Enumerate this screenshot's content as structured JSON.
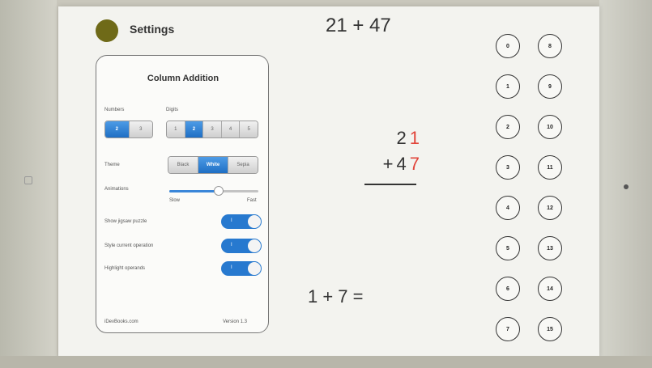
{
  "header": {
    "settings_label": "Settings"
  },
  "panel": {
    "title": "Column Addition",
    "numbers_label": "Numbers",
    "numbers_options": [
      "2",
      "3"
    ],
    "digits_label": "Digits",
    "digits_options": [
      "1",
      "2",
      "3",
      "4",
      "5"
    ],
    "theme_label": "Theme",
    "theme_options": [
      "Black",
      "White",
      "Sepia"
    ],
    "animations_label": "Animations",
    "anim_slow": "Slow",
    "anim_fast": "Fast",
    "animations_level": 0.55,
    "toggles": [
      {
        "label": "Show jigsaw puzzle",
        "value": "I"
      },
      {
        "label": "Style current operation",
        "value": "I"
      },
      {
        "label": "Highlight operands",
        "value": "I"
      }
    ],
    "footer_left": "iDevBooks.com",
    "footer_right": "Version 1.3"
  },
  "problem": {
    "header_eq": "21 + 47",
    "top_digits": [
      "2",
      "1"
    ],
    "bottom_sign": "+",
    "bottom_digits": [
      "4",
      "7"
    ],
    "sub_eq": "1 + 7 ="
  },
  "answers": [
    "0",
    "8",
    "1",
    "9",
    "2",
    "10",
    "3",
    "11",
    "4",
    "12",
    "5",
    "13",
    "6",
    "14",
    "7",
    "15"
  ],
  "colors": {
    "accent": "#1f6fc4",
    "highlight_digit": "#e1443a",
    "settings_button": "#6f6a18"
  }
}
